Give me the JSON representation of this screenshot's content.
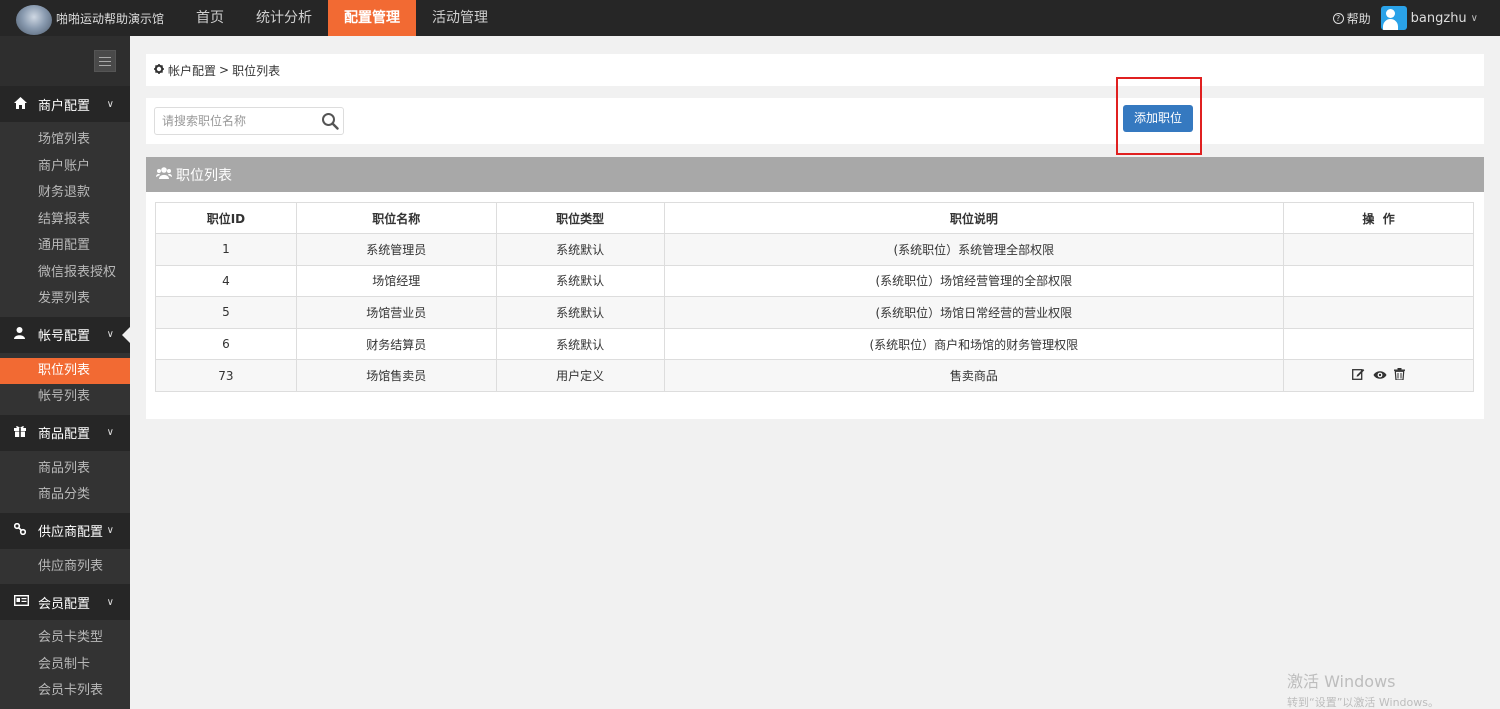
{
  "header": {
    "brand": "啪啪运动帮助演示馆",
    "nav": [
      "首页",
      "统计分析",
      "配置管理",
      "活动管理"
    ],
    "active_nav_index": 2,
    "help": "帮助",
    "username": "bangzhu"
  },
  "sidebar": {
    "groups": [
      {
        "label": "商户配置",
        "items": [
          "场馆列表",
          "商户账户",
          "财务退款",
          "结算报表",
          "通用配置",
          "微信报表授权",
          "发票列表"
        ]
      },
      {
        "label": "帐号配置",
        "items": [
          "职位列表",
          "帐号列表"
        ]
      },
      {
        "label": "商品配置",
        "items": [
          "商品列表",
          "商品分类"
        ]
      },
      {
        "label": "供应商配置",
        "items": [
          "供应商列表"
        ]
      },
      {
        "label": "会员配置",
        "items": [
          "会员卡类型",
          "会员制卡",
          "会员卡列表"
        ]
      }
    ],
    "active_item": "职位列表"
  },
  "breadcrumb": {
    "parent": "帐户配置",
    "separator": ">",
    "current": "职位列表"
  },
  "toolbar": {
    "search_placeholder": "请搜索职位名称",
    "add_button": "添加职位"
  },
  "panel": {
    "title": "职位列表",
    "columns": [
      "职位ID",
      "职位名称",
      "职位类型",
      "职位说明",
      "操  作"
    ],
    "rows": [
      {
        "id": "1",
        "name": "系统管理员",
        "type": "系统默认",
        "desc": "(系统职位）系统管理全部权限",
        "actions": false
      },
      {
        "id": "4",
        "name": "场馆经理",
        "type": "系统默认",
        "desc": "(系统职位）场馆经营管理的全部权限",
        "actions": false
      },
      {
        "id": "5",
        "name": "场馆营业员",
        "type": "系统默认",
        "desc": "(系统职位）场馆日常经营的营业权限",
        "actions": false
      },
      {
        "id": "6",
        "name": "财务结算员",
        "type": "系统默认",
        "desc": "(系统职位）商户和场馆的财务管理权限",
        "actions": false
      },
      {
        "id": "73",
        "name": "场馆售卖员",
        "type": "用户定义",
        "desc": "售卖商品",
        "actions": true
      }
    ]
  },
  "watermark": {
    "line1": "激活 Windows",
    "line2": "转到“设置”以激活 Windows。"
  },
  "colors": {
    "accent": "#f26a33",
    "primary_button": "#3579c0",
    "topbar": "#262626",
    "sidebar": "#333333",
    "highlight": "#e02020"
  }
}
